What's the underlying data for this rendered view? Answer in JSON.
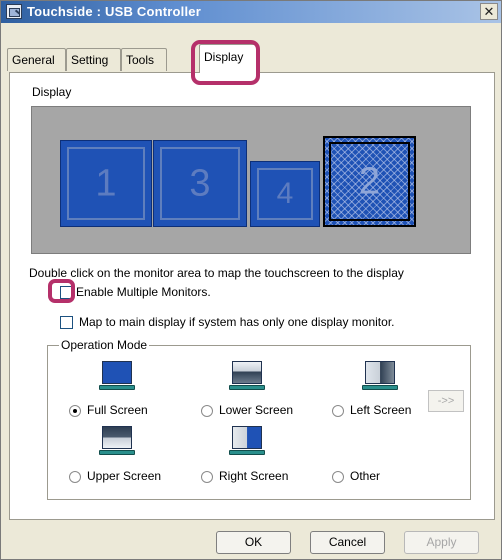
{
  "window": {
    "title": "Touchside : USB Controller",
    "close_glyph": "✕"
  },
  "tabs": [
    {
      "label": "General",
      "active": false
    },
    {
      "label": "Setting",
      "active": false
    },
    {
      "label": "Tools",
      "active": false
    },
    {
      "label": "Display",
      "active": true
    }
  ],
  "display": {
    "group_label": "Display",
    "monitors": [
      {
        "number": "1",
        "selected": false
      },
      {
        "number": "3",
        "selected": false
      },
      {
        "number": "4",
        "selected": false
      },
      {
        "number": "2",
        "selected": true
      }
    ],
    "hint": "Double click on the monitor area to map the touchscreen to the display",
    "enable_multiple_label": "Enable Multiple Monitors.",
    "enable_multiple_checked": false,
    "map_main_label": "Map to main display if system has only one display monitor.",
    "map_main_checked": false
  },
  "operation_mode": {
    "legend": "Operation Mode",
    "options": [
      {
        "label": "Full Screen",
        "selected": true,
        "icon": "full-screen-icon"
      },
      {
        "label": "Lower Screen",
        "selected": false,
        "icon": "lower-screen-icon"
      },
      {
        "label": "Left Screen",
        "selected": false,
        "icon": "left-screen-icon"
      },
      {
        "label": "Upper Screen",
        "selected": false,
        "icon": "upper-screen-icon"
      },
      {
        "label": "Right Screen",
        "selected": false,
        "icon": "right-screen-icon"
      },
      {
        "label": "Other",
        "selected": false,
        "icon": ""
      }
    ],
    "more_label": "->>"
  },
  "buttons": {
    "ok": "OK",
    "cancel": "Cancel",
    "apply": "Apply"
  },
  "colors": {
    "highlight": "#b5306a",
    "monitor_blue": "#1f52b5",
    "monitor_area": "#a6a6a6"
  }
}
